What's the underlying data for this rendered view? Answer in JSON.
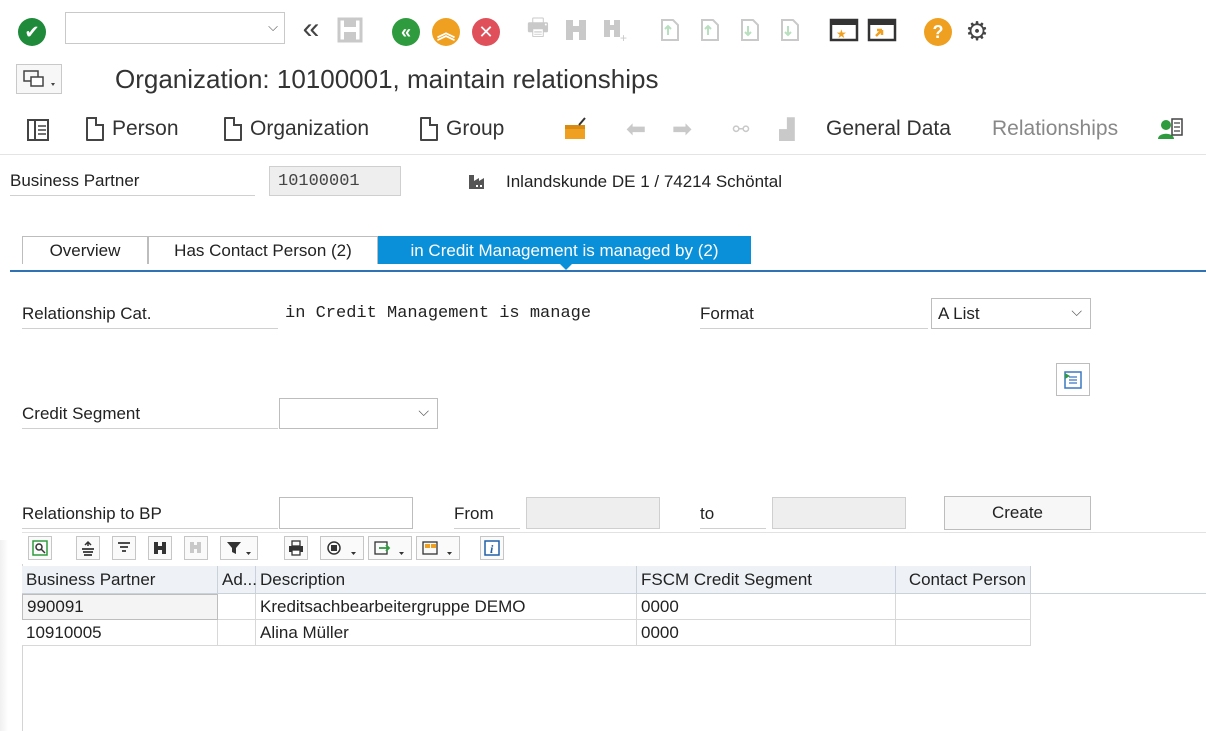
{
  "command_field": {
    "value": ""
  },
  "title": "Organization: 10100001, maintain relationships",
  "app_toolbar": {
    "person": "Person",
    "organization": "Organization",
    "group": "Group",
    "general_data": "General Data",
    "relationships": "Relationships"
  },
  "header": {
    "bp_label": "Business Partner",
    "bp_value": "10100001",
    "bp_description": "Inlandskunde DE 1 / 74214 Schöntal"
  },
  "tabs": [
    {
      "label": "Overview"
    },
    {
      "label": "Has Contact Person (2)"
    },
    {
      "label": "in Credit Management is managed by (2)"
    }
  ],
  "form": {
    "rel_cat_label": "Relationship Cat.",
    "rel_cat_value": "in Credit Management is manage",
    "format_label": "Format",
    "format_value": "A List",
    "credit_segment_label": "Credit Segment",
    "credit_segment_value": "",
    "rel_bp_label": "Relationship to BP",
    "rel_bp_value": "",
    "from_label": "From",
    "from_value": "",
    "to_label": "to",
    "to_value": "",
    "create_label": "Create"
  },
  "grid": {
    "columns": [
      "Business Partner",
      "Ad...",
      "Description",
      "FSCM Credit Segment",
      "Contact Person"
    ],
    "rows": [
      [
        "990091",
        "",
        "Kreditsachbearbeitergruppe DEMO",
        "0000",
        ""
      ],
      [
        "10910005",
        "",
        "Alina Müller",
        "0000",
        ""
      ]
    ]
  },
  "colors": {
    "accent": "#0a8fd9",
    "ok": "#1e8a3a",
    "back": "#2e9b3e",
    "exit": "#f0a020",
    "cancel": "#e0505a",
    "help": "#f0a020"
  }
}
